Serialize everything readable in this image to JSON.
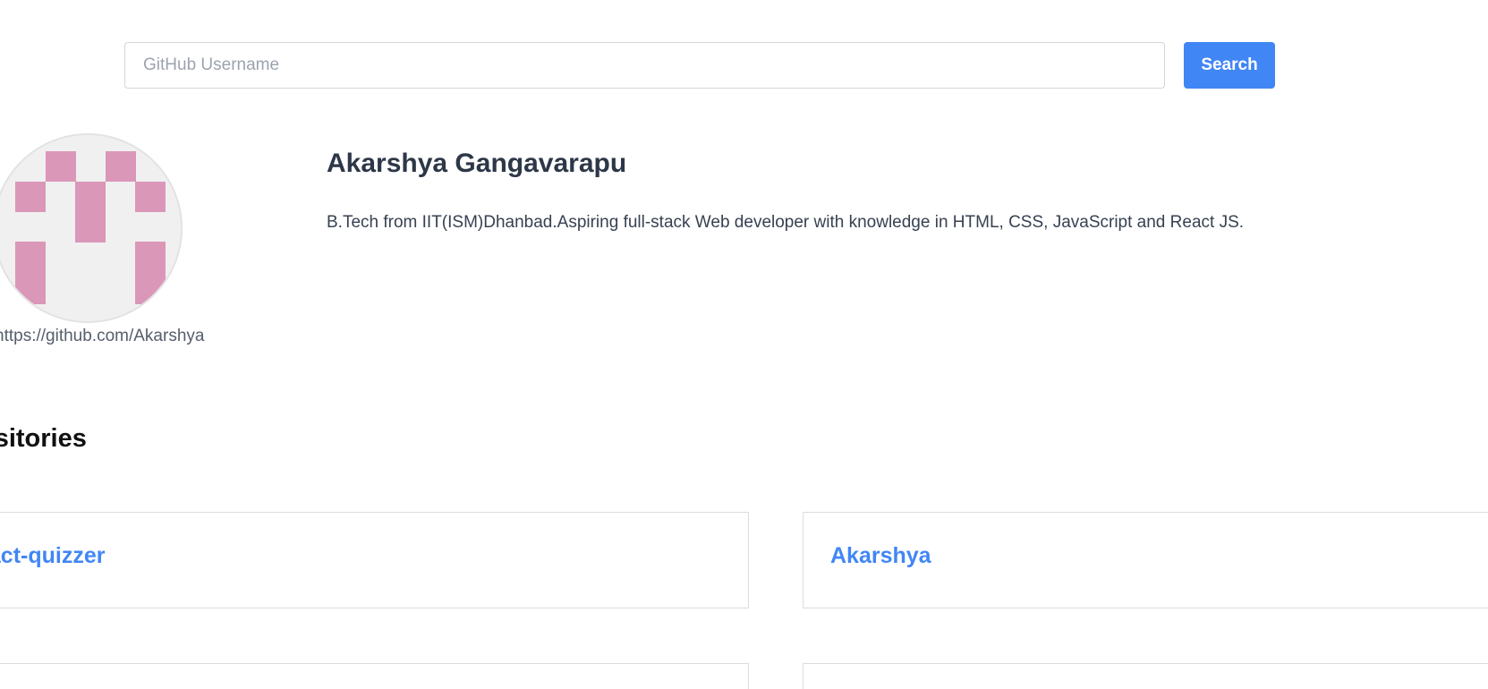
{
  "search": {
    "placeholder": "GitHub Username",
    "value": "",
    "button_label": "Search"
  },
  "profile": {
    "name": "Akarshya Gangavarapu",
    "bio": "B.Tech from IIT(ISM)Dhanbad.Aspiring full-stack Web developer with knowledge in HTML, CSS, JavaScript and React JS.",
    "link": "https://github.com/Akarshya",
    "avatar_icon": "identicon-avatar",
    "avatar_color": "#da97b8"
  },
  "repositories": {
    "heading": "ositories",
    "items": [
      {
        "name": "eact-quizzer"
      },
      {
        "name": "Akarshya"
      },
      {
        "name": ""
      },
      {
        "name": ""
      }
    ]
  },
  "colors": {
    "accent": "#4186f5",
    "text": "#2d3748"
  }
}
